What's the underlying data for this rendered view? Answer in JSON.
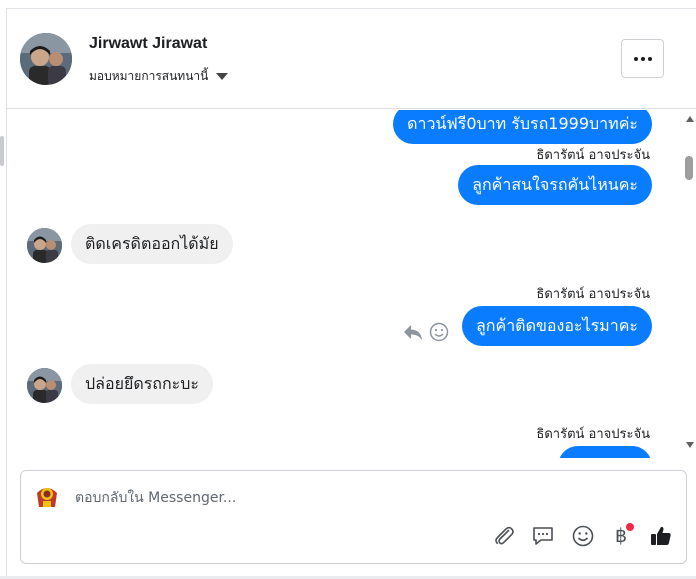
{
  "header": {
    "name": "Jirwawt Jirawat",
    "assign_label": "มอบหมายการสนทนานี้"
  },
  "messages": [
    {
      "id": "m1",
      "direction": "out",
      "text": "ดาวน์ฟรี0บาท รับรถ1999บาทค่ะ"
    },
    {
      "id": "s1",
      "type": "sender",
      "text": "ธิดารัตน์ อาจประจัน"
    },
    {
      "id": "m2",
      "direction": "out",
      "text": "ลูกค้าสนใจรถคันไหนคะ"
    },
    {
      "id": "m3",
      "direction": "in",
      "text": "ติดเครดิตออกได้มัย"
    },
    {
      "id": "s2",
      "type": "sender",
      "text": "ธิดารัตน์ อาจประจัน"
    },
    {
      "id": "m4",
      "direction": "out",
      "text": "ลูกค้าติดของอะไรมาคะ"
    },
    {
      "id": "m5",
      "direction": "in",
      "text": "ปล่อยยึดรถกะบะ"
    },
    {
      "id": "s3",
      "type": "sender",
      "text": "ธิดารัตน์ อาจประจัน"
    }
  ],
  "composer": {
    "placeholder": "ตอบกลับใน Messenger...",
    "baht_symbol": "฿"
  },
  "icons": {
    "more": "more-horizontal-icon",
    "reply": "reply-icon",
    "react": "smiley-icon",
    "attach": "paperclip-icon",
    "saved_replies": "chat-bubble-icon",
    "emoji": "emoji-icon",
    "payment": "baht-icon",
    "like": "thumbs-up-icon"
  },
  "colors": {
    "outgoing_bubble": "#0a7cff",
    "incoming_bubble": "#f0f0f0",
    "notification_dot": "#f02849"
  }
}
